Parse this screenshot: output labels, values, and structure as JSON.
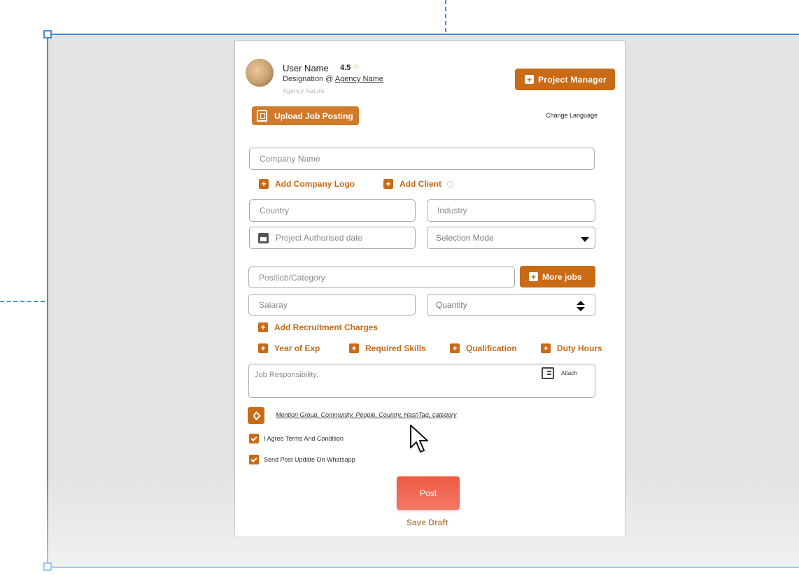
{
  "header": {
    "user_name": "User Name",
    "rating": "4.5",
    "designation_prefix": "Designation @ ",
    "agency_name": "Agency Name",
    "agency_nature": "Agency Nature",
    "project_manager_label": "Project  Manager",
    "upload_job_posting_label": "Upload Job Posting",
    "change_language_label": "Change Language"
  },
  "form": {
    "company_name_placeholder": "Company Name",
    "add_company_logo_label": "Add Company Logo",
    "add_client_label": "Add Client",
    "country_placeholder": "Country",
    "industry_placeholder": "Industry",
    "project_authorised_date_placeholder": "Project Authorised date",
    "selection_mode_value": "Selection Mode",
    "position_category_placeholder": "Positiob/Category",
    "more_jobs_label": "More jobs",
    "salary_placeholder": "Salaray",
    "quantity_value": "Quantity",
    "add_recruitment_charges_label": "Add Recruitment Charges",
    "extras": [
      {
        "label": "Year of Exp"
      },
      {
        "label": "Required Skills"
      },
      {
        "label": "Qualification"
      },
      {
        "label": "Duty Hours"
      }
    ],
    "job_responsibility_placeholder": "Job Responsibility.",
    "attach_label": "Attach",
    "mention_text": "Mention Group, Community, People, Country, HashTag, category",
    "agree_terms_label": "I Agree Terms And Condition",
    "agree_terms_checked": true,
    "whatsapp_updates_label": "Send Post Update On Whatsapp",
    "whatsapp_updates_checked": true,
    "post_label": "Post",
    "save_draft_label": "Save Draft"
  },
  "colors": {
    "accent": "#c86a16",
    "post_button": "#f05a43",
    "selection_outline": "#3d8fe0",
    "canvas_bg": "#e3e3e3"
  }
}
